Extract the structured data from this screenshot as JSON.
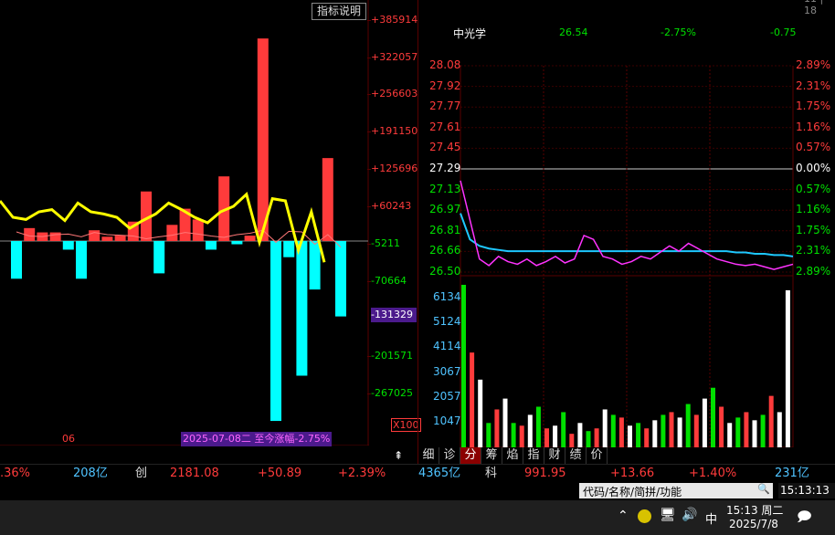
{
  "left_panel": {
    "indicator_button": "指标说明",
    "y_ticks": [
      {
        "label": "+385914",
        "color": "#ff3b3b"
      },
      {
        "label": "+322057",
        "color": "#ff3b3b"
      },
      {
        "label": "+256603",
        "color": "#ff3b3b"
      },
      {
        "label": "+191150",
        "color": "#ff3b3b"
      },
      {
        "label": "+125696",
        "color": "#ff3b3b"
      },
      {
        "label": "+60243",
        "color": "#ff3b3b"
      },
      {
        "label": "-5211",
        "color": "#00e000"
      },
      {
        "label": "-70664",
        "color": "#00e000"
      },
      {
        "label": "-131329",
        "color": "#ffffff"
      },
      {
        "label": "-201571",
        "color": "#00e000"
      },
      {
        "label": "-267025",
        "color": "#00e000"
      }
    ],
    "current_value_badge": "-131329",
    "x_label": "06",
    "date_caption": "2025-07-08二 至今涨幅-2.75%",
    "multiplier": "X100",
    "bars": [
      -35,
      12,
      8,
      8,
      -8,
      -35,
      10,
      4,
      5,
      18,
      46,
      -30,
      15,
      30,
      20,
      -8,
      60,
      -3,
      5,
      188,
      -167,
      -15,
      -125,
      -45,
      77,
      -70
    ],
    "line": [
      20,
      5,
      3,
      10,
      12,
      2,
      18,
      10,
      8,
      5,
      -5,
      2,
      8,
      18,
      12,
      5,
      0,
      10,
      15,
      26,
      -18,
      22,
      20,
      -25,
      10,
      -36
    ]
  },
  "right_panel": {
    "header": {
      "name": "中光学",
      "price": "26.54",
      "change_pct": "-2.75%",
      "change": "-0.75"
    },
    "top_truncated": "-------",
    "top_truncated_right": "11 | 18",
    "price_ticks": [
      {
        "price": "28.08",
        "pct": "2.89%",
        "color": "#ff3b3b"
      },
      {
        "price": "27.92",
        "pct": "2.31%",
        "color": "#ff3b3b"
      },
      {
        "price": "27.77",
        "pct": "1.75%",
        "color": "#ff3b3b"
      },
      {
        "price": "27.61",
        "pct": "1.16%",
        "color": "#ff3b3b"
      },
      {
        "price": "27.45",
        "pct": "0.57%",
        "color": "#ff3b3b"
      },
      {
        "price": "27.29",
        "pct": "0.00%",
        "color": "#ffffff"
      },
      {
        "price": "27.13",
        "pct": "0.57%",
        "color": "#00e000"
      },
      {
        "price": "26.97",
        "pct": "1.16%",
        "color": "#00e000"
      },
      {
        "price": "26.81",
        "pct": "1.75%",
        "color": "#00e000"
      },
      {
        "price": "26.66",
        "pct": "2.31%",
        "color": "#00e000"
      },
      {
        "price": "26.50",
        "pct": "2.89%",
        "color": "#00e000"
      }
    ],
    "volume_ticks": [
      "6134",
      "5124",
      "4114",
      "3067",
      "2057",
      "1047"
    ],
    "price_series": [
      27.2,
      26.9,
      26.6,
      26.55,
      26.62,
      26.58,
      26.56,
      26.6,
      26.55,
      26.58,
      26.62,
      26.57,
      26.6,
      26.78,
      26.75,
      26.62,
      26.6,
      26.56,
      26.58,
      26.62,
      26.6,
      26.65,
      26.7,
      26.66,
      26.72,
      26.68,
      26.64,
      26.6,
      26.58,
      26.56,
      26.55,
      26.56,
      26.54,
      26.52,
      26.54,
      26.56
    ],
    "avg_series": [
      26.95,
      26.75,
      26.7,
      26.68,
      26.67,
      26.66,
      26.66,
      26.66,
      26.66,
      26.66,
      26.66,
      26.66,
      26.66,
      26.66,
      26.66,
      26.66,
      26.66,
      26.66,
      26.66,
      26.66,
      26.66,
      26.66,
      26.66,
      26.66,
      26.66,
      26.66,
      26.66,
      26.66,
      26.66,
      26.65,
      26.65,
      26.64,
      26.64,
      26.63,
      26.63,
      26.62
    ],
    "volume_bars": [
      6000,
      3500,
      2500,
      900,
      1400,
      1800,
      900,
      800,
      1200,
      1500,
      700,
      800,
      1300,
      500,
      900,
      600,
      700,
      1400,
      1200,
      1100,
      800,
      900,
      700,
      1000,
      1200,
      1300,
      1100,
      1600,
      1200,
      1800,
      2200,
      1500,
      900,
      1100,
      1300,
      1000,
      1200,
      1900,
      1300,
      5800
    ]
  },
  "tabs": [
    "细",
    "诊",
    "分",
    "筹",
    "焰",
    "指",
    "财",
    "绩",
    "价"
  ],
  "active_tab": "分",
  "status": {
    "pct_left": ".36%",
    "amt1": "208亿",
    "name2": "创",
    "idx2": "2181.08",
    "chg2": "+50.89",
    "pct2": "+2.39%",
    "amt2": "4365亿",
    "name3": "科",
    "idx3": "991.95",
    "chg3": "+13.66",
    "pct3": "+1.40%",
    "amt3": "231亿"
  },
  "search_box": {
    "placeholder": "代码/名称/简拼/功能"
  },
  "clock_box": "15:13:13",
  "taskbar": {
    "time": "15:13 周二",
    "date": "2025/7/8",
    "ime": "中"
  },
  "colors": {
    "up": "#ff3b3b",
    "down": "#00e000",
    "cyan": "#00ffff",
    "yellow": "#ffff00",
    "magenta": "#ff33ff",
    "grid": "#5a0000"
  }
}
